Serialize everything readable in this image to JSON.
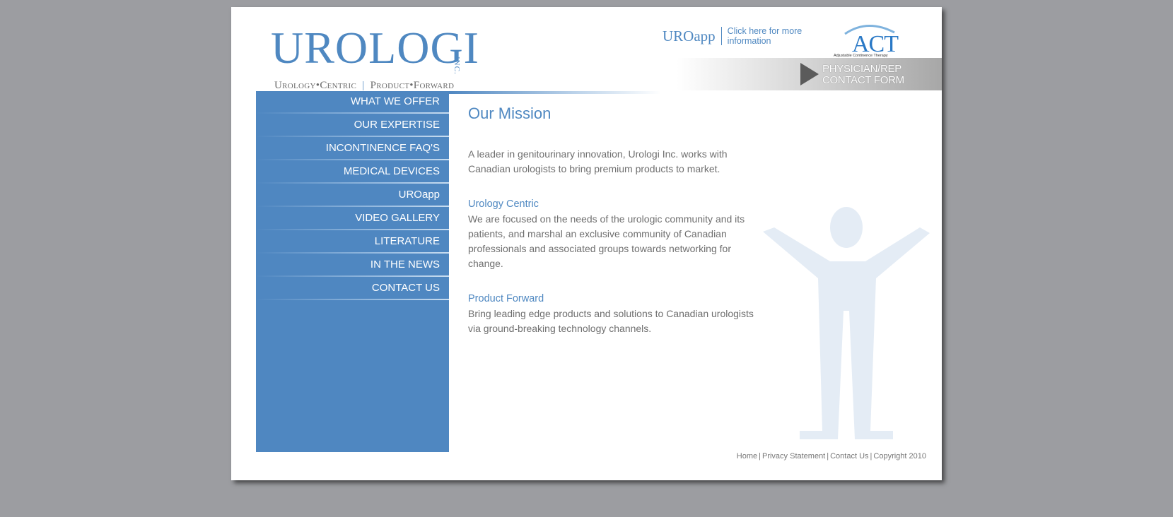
{
  "header": {
    "logo_word": "UROLOGI",
    "logo_inc": "INC.",
    "tagline_left": "Urology•Centric",
    "tagline_right": "Product•Forward",
    "uroapp_name": "UROapp",
    "uroapp_more": "Click here for more information",
    "act_logo": "ACT",
    "act_sub": "Adjustable Continence Therapy",
    "contact_line1": "PHYSICIAN/REP",
    "contact_line2": "CONTACT FORM"
  },
  "nav": {
    "items": [
      {
        "label": "WHAT WE OFFER"
      },
      {
        "label": "OUR EXPERTISE"
      },
      {
        "label": "INCONTINENCE FAQ'S"
      },
      {
        "label": "MEDICAL DEVICES"
      },
      {
        "label": "UROapp"
      },
      {
        "label": "VIDEO GALLERY"
      },
      {
        "label": "LITERATURE"
      },
      {
        "label": "IN THE NEWS"
      },
      {
        "label": "CONTACT US"
      }
    ]
  },
  "main": {
    "title": "Our Mission",
    "intro": "A leader in genitourinary innovation, Urologi Inc. works with Canadian urologists to bring premium products to market.",
    "sections": [
      {
        "heading": "Urology Centric",
        "body": "We are focused on the needs of the urologic community and its patients, and marshal an exclusive community of Canadian professionals and associated groups towards networking for change."
      },
      {
        "heading": "Product Forward",
        "body": "Bring leading edge products and solutions to Canadian urologists via ground-breaking technology channels."
      }
    ]
  },
  "footer": {
    "links": [
      "Home",
      "Privacy Statement",
      "Contact Us"
    ],
    "separator": "|",
    "copyright": "Copyright 2010"
  },
  "colors": {
    "background": "#9c9da1",
    "brand_blue": "#4f88c1",
    "nav_blue": "#4f87c1",
    "figure": "#e4ecf5",
    "text": "#6f6f6f"
  }
}
